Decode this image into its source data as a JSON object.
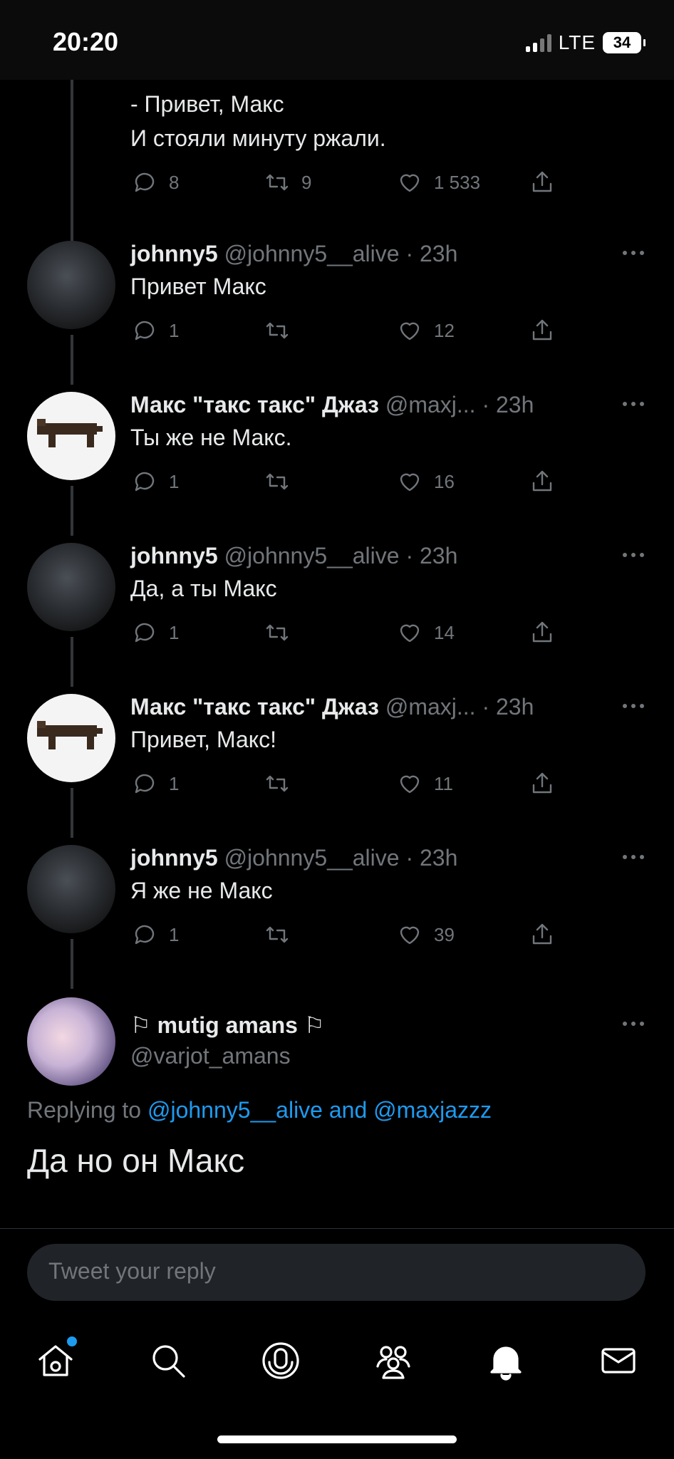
{
  "status_bar": {
    "time": "20:20",
    "network": "LTE",
    "battery": "34"
  },
  "top_tweet": {
    "lines": [
      "- Привет, Макс",
      "И стояли минуту ржали."
    ],
    "replies": "8",
    "retweets": "9",
    "likes": "1 533"
  },
  "tweets": [
    {
      "name": "johnny5",
      "meta": "@johnny5__alive · 23h",
      "text": "Привет Макс",
      "replies": "1",
      "retweets": "",
      "likes": "12"
    },
    {
      "name": "Макс \"такс такс\" Джаз",
      "meta": "@maxj... · 23h",
      "text": "Ты же не Макс.",
      "replies": "1",
      "retweets": "",
      "likes": "16"
    },
    {
      "name": "johnny5",
      "meta": "@johnny5__alive · 23h",
      "text": "Да, а ты Макс",
      "replies": "1",
      "retweets": "",
      "likes": "14"
    },
    {
      "name": "Макс \"такс такс\" Джаз",
      "meta": "@maxj... · 23h",
      "text": "Привет, Макс!",
      "replies": "1",
      "retweets": "",
      "likes": "11"
    },
    {
      "name": "johnny5",
      "meta": "@johnny5__alive · 23h",
      "text": "Я же не Макс",
      "replies": "1",
      "retweets": "",
      "likes": "39"
    }
  ],
  "main_tweet": {
    "name": "mutig amans",
    "handle": "@varjot_amans",
    "replying_label": "Replying to",
    "mention1": "@johnny5__alive",
    "and": "and",
    "mention2": "@maxjazzz",
    "text": "Да но он Макс"
  },
  "reply_box": {
    "placeholder": "Tweet your reply"
  },
  "colors": {
    "accent": "#1d9bf0",
    "muted": "#71767b",
    "background": "#000000"
  },
  "tabbar": {
    "icons": [
      "home-icon",
      "search-icon",
      "spaces-icon",
      "communities-icon",
      "notifications-icon",
      "messages-icon"
    ]
  }
}
